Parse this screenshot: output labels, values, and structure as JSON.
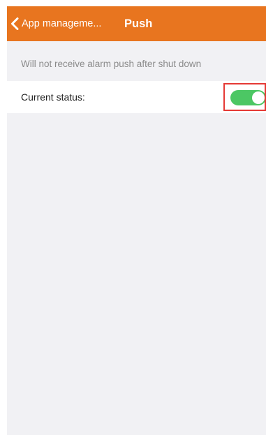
{
  "header": {
    "back_label": "App manageme...",
    "back_icon": "chevron-left-icon",
    "title": "Push",
    "color": "#e8751f"
  },
  "notice": "Will not receive alarm push after shut down",
  "status": {
    "label": "Current status:",
    "toggle_on": true,
    "toggle_color": "#4cc764",
    "highlight_color": "#e53935"
  }
}
